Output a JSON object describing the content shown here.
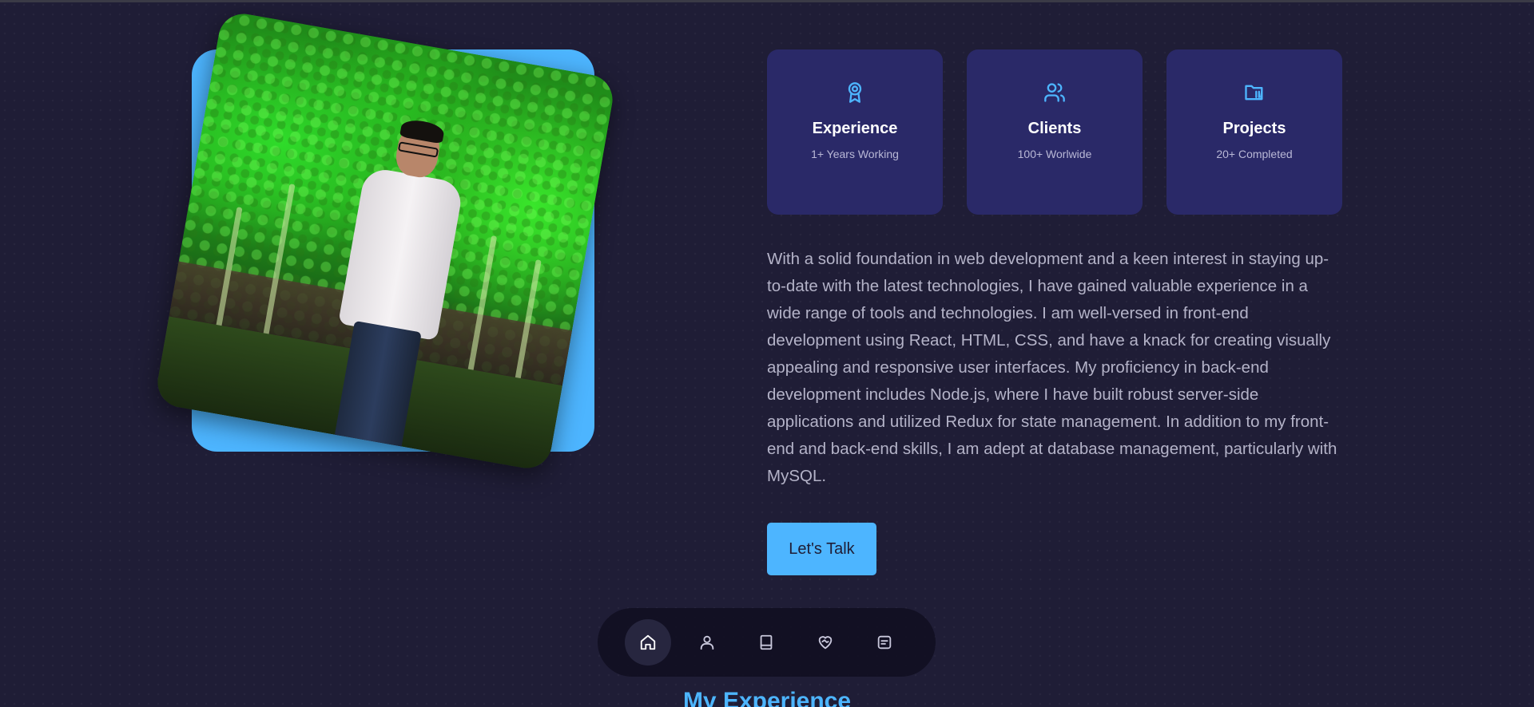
{
  "colors": {
    "background": "#1f1d36",
    "accent": "#4db5ff",
    "card": "#2a2968"
  },
  "profile_photo": {
    "subject": "man in white shirt standing in front of green-lit trees"
  },
  "stats": [
    {
      "icon": "award-icon",
      "title": "Experience",
      "subtitle": "1+ Years Working"
    },
    {
      "icon": "users-icon",
      "title": "Clients",
      "subtitle": "100+ Worlwide"
    },
    {
      "icon": "folder-icon",
      "title": "Projects",
      "subtitle": "20+ Completed"
    }
  ],
  "about": {
    "text": "With a solid foundation in web development and a keen interest in staying up-to-date with the latest technologies, I have gained valuable experience in a wide range of tools and technologies. I am well-versed in front-end development using React, HTML, CSS, and have a knack for creating visually appealing and responsive user interfaces. My proficiency in back-end development includes Node.js, where I have built robust server-side applications and utilized Redux for state management. In addition to my front-end and back-end skills, I am adept at database management, particularly with MySQL."
  },
  "cta": {
    "label": "Let's Talk"
  },
  "nav": {
    "items": [
      {
        "icon": "home-icon",
        "active": true
      },
      {
        "icon": "user-icon",
        "active": false
      },
      {
        "icon": "book-icon",
        "active": false
      },
      {
        "icon": "heart-handshake-icon",
        "active": false
      },
      {
        "icon": "message-icon",
        "active": false
      }
    ]
  },
  "next_section": {
    "title": "My Experience"
  }
}
